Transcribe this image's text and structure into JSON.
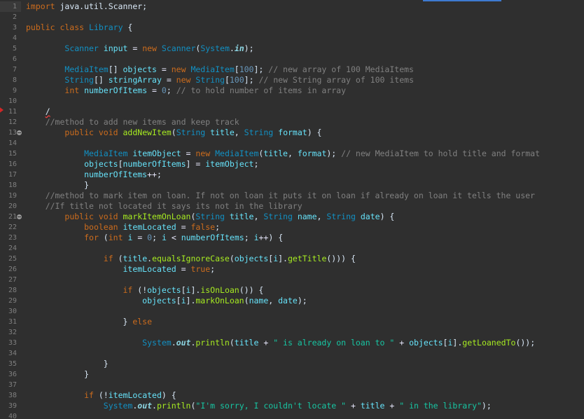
{
  "editor": {
    "gutter": {
      "line_numbers": [
        "1",
        "2",
        "3",
        "4",
        "5",
        "6",
        "7",
        "8",
        "9",
        "10",
        "11",
        "12",
        "13",
        "14",
        "15",
        "16",
        "17",
        "18",
        "19",
        "20",
        "21",
        "22",
        "23",
        "24",
        "25",
        "26",
        "27",
        "28",
        "29",
        "30",
        "31",
        "32",
        "33",
        "34",
        "35",
        "36",
        "37",
        "38",
        "39",
        "40"
      ],
      "fold_lines": [
        13,
        21
      ],
      "warning_line": 11,
      "current_line": 1
    },
    "lines": [
      [
        [
          "kw",
          "import"
        ],
        [
          "pl",
          " java.util.Scanner;"
        ]
      ],
      [],
      [
        [
          "kw",
          "public class"
        ],
        [
          "pl",
          " "
        ],
        [
          "ty",
          "Library"
        ],
        [
          "pl",
          " {"
        ]
      ],
      [],
      [
        [
          "pl",
          "        "
        ],
        [
          "ty",
          "Scanner"
        ],
        [
          "pl",
          " "
        ],
        [
          "vr",
          "input"
        ],
        [
          "op",
          " = "
        ],
        [
          "kw",
          "new"
        ],
        [
          "pl",
          " "
        ],
        [
          "ty",
          "Scanner"
        ],
        [
          "pl",
          "("
        ],
        [
          "ty",
          "System"
        ],
        [
          "pl",
          "."
        ],
        [
          "sf",
          "in"
        ],
        [
          "pl",
          ");"
        ]
      ],
      [],
      [
        [
          "pl",
          "        "
        ],
        [
          "ty",
          "MediaItem"
        ],
        [
          "pl",
          "[] "
        ],
        [
          "vr",
          "objects"
        ],
        [
          "op",
          " = "
        ],
        [
          "kw",
          "new"
        ],
        [
          "pl",
          " "
        ],
        [
          "ty",
          "MediaItem"
        ],
        [
          "pl",
          "["
        ],
        [
          "nu",
          "100"
        ],
        [
          "pl",
          "]; "
        ],
        [
          "cm",
          "// new array of 100 MediaItems"
        ]
      ],
      [
        [
          "pl",
          "        "
        ],
        [
          "ty",
          "String"
        ],
        [
          "pl",
          "[] "
        ],
        [
          "vr",
          "stringArray"
        ],
        [
          "op",
          " = "
        ],
        [
          "kw",
          "new"
        ],
        [
          "pl",
          " "
        ],
        [
          "ty",
          "String"
        ],
        [
          "pl",
          "["
        ],
        [
          "nu",
          "100"
        ],
        [
          "pl",
          "]; "
        ],
        [
          "cm",
          "// new String array of 100 items"
        ]
      ],
      [
        [
          "pl",
          "        "
        ],
        [
          "kw",
          "int"
        ],
        [
          "pl",
          " "
        ],
        [
          "vr",
          "numberOfItems"
        ],
        [
          "op",
          " = "
        ],
        [
          "nu",
          "0"
        ],
        [
          "pl",
          "; "
        ],
        [
          "cm",
          "// to hold number of items in array"
        ]
      ],
      [],
      [
        [
          "pl",
          "    "
        ],
        [
          "er",
          "/"
        ]
      ],
      [
        [
          "pl",
          "    "
        ],
        [
          "cm",
          "//method to add new items and keep track"
        ]
      ],
      [
        [
          "pl",
          "        "
        ],
        [
          "kw",
          "public void"
        ],
        [
          "pl",
          " "
        ],
        [
          "fn",
          "addNewItem"
        ],
        [
          "pl",
          "("
        ],
        [
          "ty",
          "String"
        ],
        [
          "pl",
          " "
        ],
        [
          "vr",
          "title"
        ],
        [
          "pl",
          ", "
        ],
        [
          "ty",
          "String"
        ],
        [
          "pl",
          " "
        ],
        [
          "vr",
          "format"
        ],
        [
          "pl",
          ") {"
        ]
      ],
      [],
      [
        [
          "pl",
          "            "
        ],
        [
          "ty",
          "MediaItem"
        ],
        [
          "pl",
          " "
        ],
        [
          "vr",
          "itemObject"
        ],
        [
          "op",
          " = "
        ],
        [
          "kw",
          "new"
        ],
        [
          "pl",
          " "
        ],
        [
          "ty",
          "MediaItem"
        ],
        [
          "pl",
          "("
        ],
        [
          "vr",
          "title"
        ],
        [
          "pl",
          ", "
        ],
        [
          "vr",
          "format"
        ],
        [
          "pl",
          "); "
        ],
        [
          "cm",
          "// new MediaItem to hold title and format"
        ]
      ],
      [
        [
          "pl",
          "            "
        ],
        [
          "vr",
          "objects"
        ],
        [
          "pl",
          "["
        ],
        [
          "vr",
          "numberOfItems"
        ],
        [
          "pl",
          "]"
        ],
        [
          "op",
          " = "
        ],
        [
          "vr",
          "itemObject"
        ],
        [
          "pl",
          ";"
        ]
      ],
      [
        [
          "pl",
          "            "
        ],
        [
          "vr",
          "numberOfItems"
        ],
        [
          "op",
          "++"
        ],
        [
          "pl",
          ";"
        ]
      ],
      [
        [
          "pl",
          "            }"
        ]
      ],
      [
        [
          "pl",
          "    "
        ],
        [
          "cm",
          "//method to mark item on loan. If not on loan it puts it on loan if already on loan it tells the user"
        ]
      ],
      [
        [
          "pl",
          "    "
        ],
        [
          "cm",
          "//If title not located it says its not in the library"
        ]
      ],
      [
        [
          "pl",
          "        "
        ],
        [
          "kw",
          "public void"
        ],
        [
          "pl",
          " "
        ],
        [
          "fn",
          "markItemOnLoan"
        ],
        [
          "pl",
          "("
        ],
        [
          "ty",
          "String"
        ],
        [
          "pl",
          " "
        ],
        [
          "vr",
          "title"
        ],
        [
          "pl",
          ", "
        ],
        [
          "ty",
          "String"
        ],
        [
          "pl",
          " "
        ],
        [
          "vr",
          "name"
        ],
        [
          "pl",
          ", "
        ],
        [
          "ty",
          "String"
        ],
        [
          "pl",
          " "
        ],
        [
          "vr",
          "date"
        ],
        [
          "pl",
          ") {"
        ]
      ],
      [
        [
          "pl",
          "            "
        ],
        [
          "kw",
          "boolean"
        ],
        [
          "pl",
          " "
        ],
        [
          "vr",
          "itemLocated"
        ],
        [
          "op",
          " = "
        ],
        [
          "kw",
          "false"
        ],
        [
          "pl",
          ";"
        ]
      ],
      [
        [
          "pl",
          "            "
        ],
        [
          "kw",
          "for"
        ],
        [
          "pl",
          " ("
        ],
        [
          "kw",
          "int"
        ],
        [
          "pl",
          " "
        ],
        [
          "vr",
          "i"
        ],
        [
          "op",
          " = "
        ],
        [
          "nu",
          "0"
        ],
        [
          "pl",
          "; "
        ],
        [
          "vr",
          "i"
        ],
        [
          "op",
          " < "
        ],
        [
          "vr",
          "numberOfItems"
        ],
        [
          "pl",
          "; "
        ],
        [
          "vr",
          "i"
        ],
        [
          "op",
          "++"
        ],
        [
          "pl",
          ") {"
        ]
      ],
      [],
      [
        [
          "pl",
          "                "
        ],
        [
          "kw",
          "if"
        ],
        [
          "pl",
          " ("
        ],
        [
          "vr",
          "title"
        ],
        [
          "pl",
          "."
        ],
        [
          "fn",
          "equalsIgnoreCase"
        ],
        [
          "pl",
          "("
        ],
        [
          "vr",
          "objects"
        ],
        [
          "pl",
          "["
        ],
        [
          "vr",
          "i"
        ],
        [
          "pl",
          "]."
        ],
        [
          "fn",
          "getTitle"
        ],
        [
          "pl",
          "())) {"
        ]
      ],
      [
        [
          "pl",
          "                    "
        ],
        [
          "vr",
          "itemLocated"
        ],
        [
          "op",
          " = "
        ],
        [
          "kw",
          "true"
        ],
        [
          "pl",
          ";"
        ]
      ],
      [],
      [
        [
          "pl",
          "                    "
        ],
        [
          "kw",
          "if"
        ],
        [
          "pl",
          " (!"
        ],
        [
          "vr",
          "objects"
        ],
        [
          "pl",
          "["
        ],
        [
          "vr",
          "i"
        ],
        [
          "pl",
          "]."
        ],
        [
          "fn",
          "isOnLoan"
        ],
        [
          "pl",
          "()) {"
        ]
      ],
      [
        [
          "pl",
          "                        "
        ],
        [
          "vr",
          "objects"
        ],
        [
          "pl",
          "["
        ],
        [
          "vr",
          "i"
        ],
        [
          "pl",
          "]."
        ],
        [
          "fn",
          "markOnLoan"
        ],
        [
          "pl",
          "("
        ],
        [
          "vr",
          "name"
        ],
        [
          "pl",
          ", "
        ],
        [
          "vr",
          "date"
        ],
        [
          "pl",
          ");"
        ]
      ],
      [],
      [
        [
          "pl",
          "                    } "
        ],
        [
          "kw",
          "else"
        ]
      ],
      [],
      [
        [
          "pl",
          "                        "
        ],
        [
          "ty",
          "System"
        ],
        [
          "pl",
          "."
        ],
        [
          "sf",
          "out"
        ],
        [
          "pl",
          "."
        ],
        [
          "fn",
          "println"
        ],
        [
          "pl",
          "("
        ],
        [
          "vr",
          "title"
        ],
        [
          "op",
          " + "
        ],
        [
          "st",
          "\" is already on loan to \""
        ],
        [
          "op",
          " + "
        ],
        [
          "vr",
          "objects"
        ],
        [
          "pl",
          "["
        ],
        [
          "vr",
          "i"
        ],
        [
          "pl",
          "]."
        ],
        [
          "fn",
          "getLoanedTo"
        ],
        [
          "pl",
          "());"
        ]
      ],
      [],
      [
        [
          "pl",
          "                }"
        ]
      ],
      [
        [
          "pl",
          "            }"
        ]
      ],
      [],
      [
        [
          "pl",
          "            "
        ],
        [
          "kw",
          "if"
        ],
        [
          "pl",
          " (!"
        ],
        [
          "vr",
          "itemLocated"
        ],
        [
          "pl",
          ") {"
        ]
      ],
      [
        [
          "pl",
          "                "
        ],
        [
          "ty",
          "System"
        ],
        [
          "pl",
          "."
        ],
        [
          "sf",
          "out"
        ],
        [
          "pl",
          "."
        ],
        [
          "fn",
          "println"
        ],
        [
          "pl",
          "("
        ],
        [
          "st",
          "\"I'm sorry, I couldn't locate \""
        ],
        [
          "op",
          " + "
        ],
        [
          "vr",
          "title"
        ],
        [
          "op",
          " + "
        ],
        [
          "st",
          "\" in the library\""
        ],
        [
          "pl",
          ");"
        ]
      ],
      []
    ]
  }
}
